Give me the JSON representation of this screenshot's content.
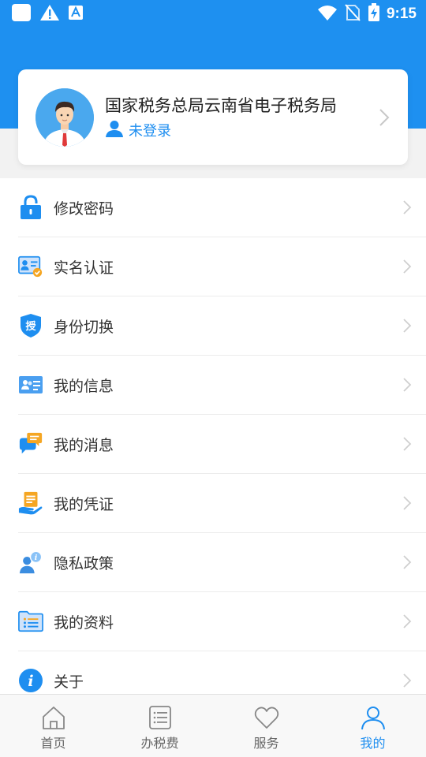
{
  "status_bar": {
    "time": "9:15",
    "icons": [
      "app-notification-icon",
      "warning-icon",
      "font-a-icon",
      "wifi-icon",
      "no-sim-icon",
      "battery-charging-icon"
    ]
  },
  "profile": {
    "title": "国家税务总局云南省电子税务局",
    "login_status": "未登录",
    "colors": {
      "accent": "#1e8ef0",
      "header": "#1e90f0"
    }
  },
  "menu": {
    "items": [
      {
        "label": "修改密码",
        "icon": "lock-icon"
      },
      {
        "label": "实名认证",
        "icon": "id-verify-icon"
      },
      {
        "label": "身份切换",
        "icon": "shield-authorize-icon"
      },
      {
        "label": "我的信息",
        "icon": "info-card-icon"
      },
      {
        "label": "我的消息",
        "icon": "chat-bubble-icon"
      },
      {
        "label": "我的凭证",
        "icon": "voucher-hand-icon"
      },
      {
        "label": "隐私政策",
        "icon": "privacy-user-icon"
      },
      {
        "label": "我的资料",
        "icon": "folder-list-icon"
      },
      {
        "label": "关于",
        "icon": "info-circle-icon"
      }
    ]
  },
  "tabs": [
    {
      "label": "首页",
      "icon": "home-icon",
      "active": false
    },
    {
      "label": "办税费",
      "icon": "list-icon",
      "active": false
    },
    {
      "label": "服务",
      "icon": "heart-icon",
      "active": false
    },
    {
      "label": "我的",
      "icon": "user-icon",
      "active": true
    }
  ]
}
